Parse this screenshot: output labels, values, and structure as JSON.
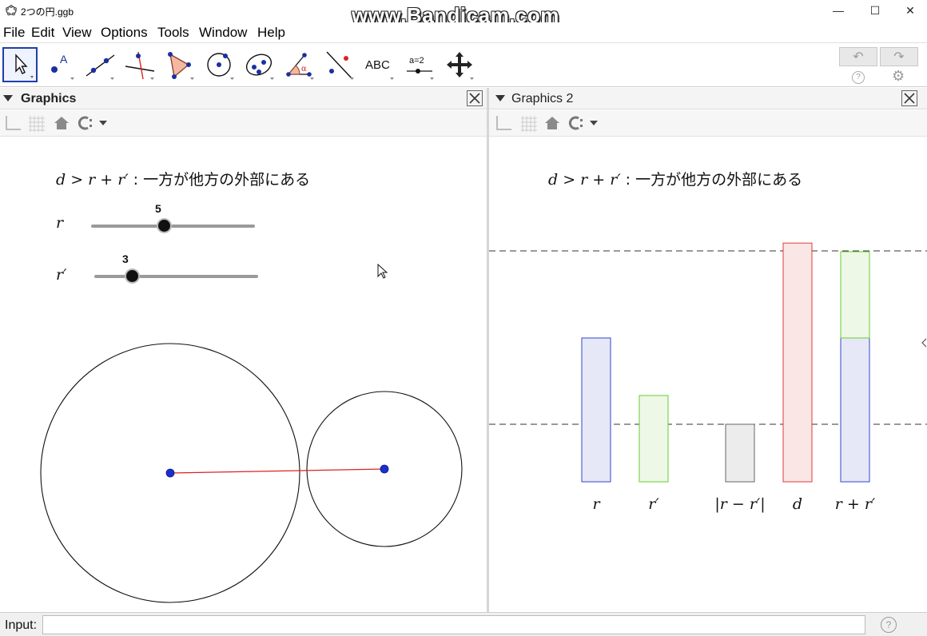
{
  "window": {
    "title": "2つの円.ggb",
    "watermark": "www.Bandicam.com",
    "controls": {
      "minimize": "—",
      "maximize": "☐",
      "close": "✕"
    }
  },
  "menu": [
    "File",
    "Edit",
    "View",
    "Options",
    "Tools",
    "Window",
    "Help"
  ],
  "toolbar": {
    "tools": [
      {
        "name": "move-tool-icon"
      },
      {
        "name": "point-tool-icon",
        "label": "A"
      },
      {
        "name": "line-tool-icon"
      },
      {
        "name": "perpendicular-line-tool-icon"
      },
      {
        "name": "polygon-tool-icon"
      },
      {
        "name": "circle-center-point-tool-icon"
      },
      {
        "name": "ellipse-tool-icon"
      },
      {
        "name": "angle-tool-icon",
        "label": "α"
      },
      {
        "name": "reflect-tool-icon"
      },
      {
        "name": "text-tool-icon",
        "label": "ABC"
      },
      {
        "name": "slider-tool-icon",
        "label": "a=2"
      },
      {
        "name": "move-graphics-view-tool-icon"
      }
    ],
    "undo": "↶",
    "redo": "↷",
    "help": "?",
    "settings": "⚙"
  },
  "graphics1": {
    "title": "Graphics",
    "heading_math": "d > r + r′",
    "heading_text": " : 一方が他方の外部にある",
    "slider_r": {
      "label": "r",
      "value": "5",
      "min": 0,
      "max": 10
    },
    "slider_rp": {
      "label": "r′",
      "value": "3",
      "min": 0,
      "max": 10
    }
  },
  "graphics2": {
    "title": "Graphics 2",
    "heading_math": "d > r + r′",
    "heading_text": " : 一方が他方の外部にある",
    "bars": [
      {
        "label": "r",
        "value": 5,
        "color": "#3344cc",
        "fill": "#e6e8f7"
      },
      {
        "label": "r′",
        "value": 3,
        "color": "#66cc33",
        "fill": "#eef8e6"
      },
      {
        "label": "|r − r′|",
        "value": 2,
        "color": "#666666",
        "fill": "#ececec"
      },
      {
        "label": "d",
        "value": 8.3,
        "color": "#e03a3a",
        "fill": "#fbe6e6"
      },
      {
        "label": "r + r′",
        "segments": [
          {
            "value": 5,
            "color": "#3344cc",
            "fill": "#e6e8f7"
          },
          {
            "value": 3,
            "color": "#66cc33",
            "fill": "#eef8e6"
          }
        ]
      }
    ]
  },
  "input": {
    "label": "Input:",
    "value": ""
  }
}
